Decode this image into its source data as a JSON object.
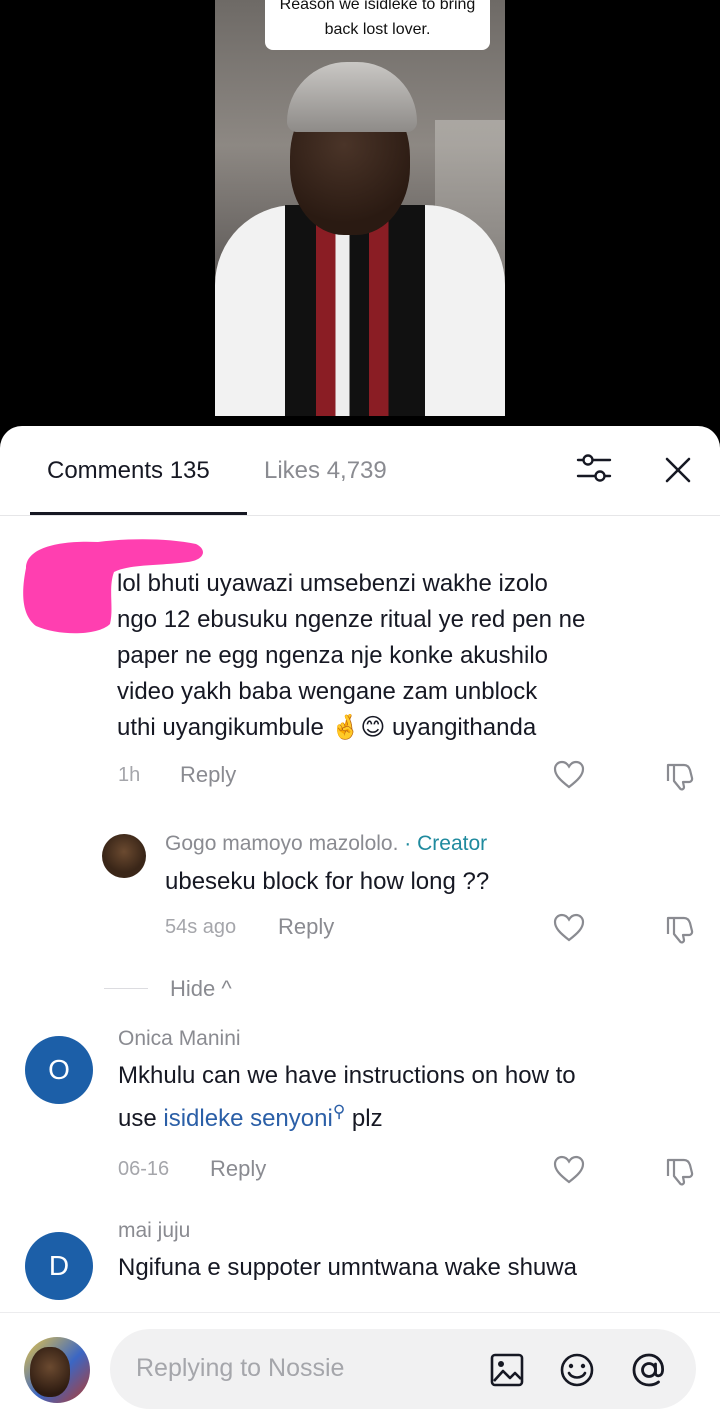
{
  "video": {
    "caption_line1": "Reason we isidleke to bring",
    "caption_line2": "back lost lover."
  },
  "tabs": {
    "comments_label": "Comments 135",
    "likes_label": "Likes 4,739"
  },
  "comments": [
    {
      "text_lines": [
        "lol bhuti uyawazi umsebenzi wakhe izolo",
        "ngo 12 ebusuku ngenze ritual ye red pen ne",
        "paper ne egg ngenza nje konke akushilo",
        "video yakh baba wengane zam unblock"
      ],
      "last_line_start": "uthi uyangikumbule ",
      "emojis": "🤞😊",
      "last_line_end": " uyangithanda",
      "time": "1h",
      "reply_label": "Reply"
    },
    {
      "name": "Gogo mamoyo mazololo.",
      "creator_tag": " · Creator",
      "text": "ubeseku block for how long ??",
      "time": "54s ago",
      "reply_label": "Reply"
    },
    {
      "name": "Onica Manini",
      "avatar_letter": "O",
      "text_line1": "Mkhulu can we have instructions on how to",
      "text_line2_pre": "use ",
      "link_text": "isidleke senyoni",
      "link_icon": "search-icon",
      "text_line2_post": " plz",
      "time": "06-16",
      "reply_label": "Reply"
    },
    {
      "name": "mai juju",
      "avatar_letter": "D",
      "text": "Ngifuna e suppoter umntwana wake shuwa"
    }
  ],
  "hide_label": "Hide ^",
  "input": {
    "placeholder": "Replying to Nossie",
    "icons": [
      "image-icon",
      "emoji-icon",
      "mention-icon"
    ]
  },
  "colors": {
    "creator": "#1f8a9e",
    "link": "#2b5fa7",
    "avatar_blue": "#1c5fa8",
    "redaction_pink": "#ff3fb0"
  }
}
